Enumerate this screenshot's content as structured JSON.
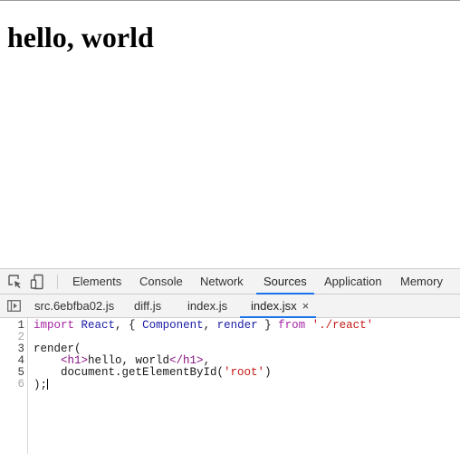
{
  "page": {
    "heading": "hello, world"
  },
  "devtools": {
    "panel_tabs": [
      {
        "label": "Elements",
        "active": false
      },
      {
        "label": "Console",
        "active": false
      },
      {
        "label": "Network",
        "active": false
      },
      {
        "label": "Sources",
        "active": true
      },
      {
        "label": "Application",
        "active": false
      },
      {
        "label": "Memory",
        "active": false
      }
    ],
    "file_tabs": [
      {
        "label": "src.6ebfba02.js",
        "active": false
      },
      {
        "label": "diff.js",
        "active": false
      },
      {
        "label": "index.js",
        "active": false
      },
      {
        "label": "index.jsx",
        "active": true,
        "close": "×"
      }
    ],
    "toolbar_icons": [
      "inspect-element-icon",
      "device-toolbar-icon"
    ],
    "navigator_toggle_icon": "navigator-toggle-icon",
    "accent_color": "#1a73e8",
    "editor": {
      "line_numbers": [
        "1",
        "2",
        "3",
        "4",
        "5",
        "6"
      ],
      "lines": [
        {
          "tokens": [
            {
              "t": "import",
              "c": "kw"
            },
            {
              "t": " ",
              "c": ""
            },
            {
              "t": "React",
              "c": "id"
            },
            {
              "t": ", { ",
              "c": ""
            },
            {
              "t": "Component",
              "c": "id"
            },
            {
              "t": ", ",
              "c": ""
            },
            {
              "t": "render",
              "c": "id"
            },
            {
              "t": " } ",
              "c": ""
            },
            {
              "t": "from",
              "c": "kw"
            },
            {
              "t": " ",
              "c": ""
            },
            {
              "t": "'./react'",
              "c": "str"
            }
          ]
        },
        {
          "tokens": []
        },
        {
          "tokens": [
            {
              "t": "render(",
              "c": ""
            }
          ]
        },
        {
          "tokens": [
            {
              "t": "    ",
              "c": ""
            },
            {
              "t": "<h1>",
              "c": "tag"
            },
            {
              "t": "hello, world",
              "c": ""
            },
            {
              "t": "</h1>",
              "c": "tag"
            },
            {
              "t": ",",
              "c": ""
            }
          ]
        },
        {
          "tokens": [
            {
              "t": "    document.getElementById(",
              "c": ""
            },
            {
              "t": "'root'",
              "c": "str"
            },
            {
              "t": ")",
              "c": ""
            }
          ]
        },
        {
          "tokens": [
            {
              "t": ");",
              "c": ""
            }
          ]
        }
      ]
    }
  }
}
